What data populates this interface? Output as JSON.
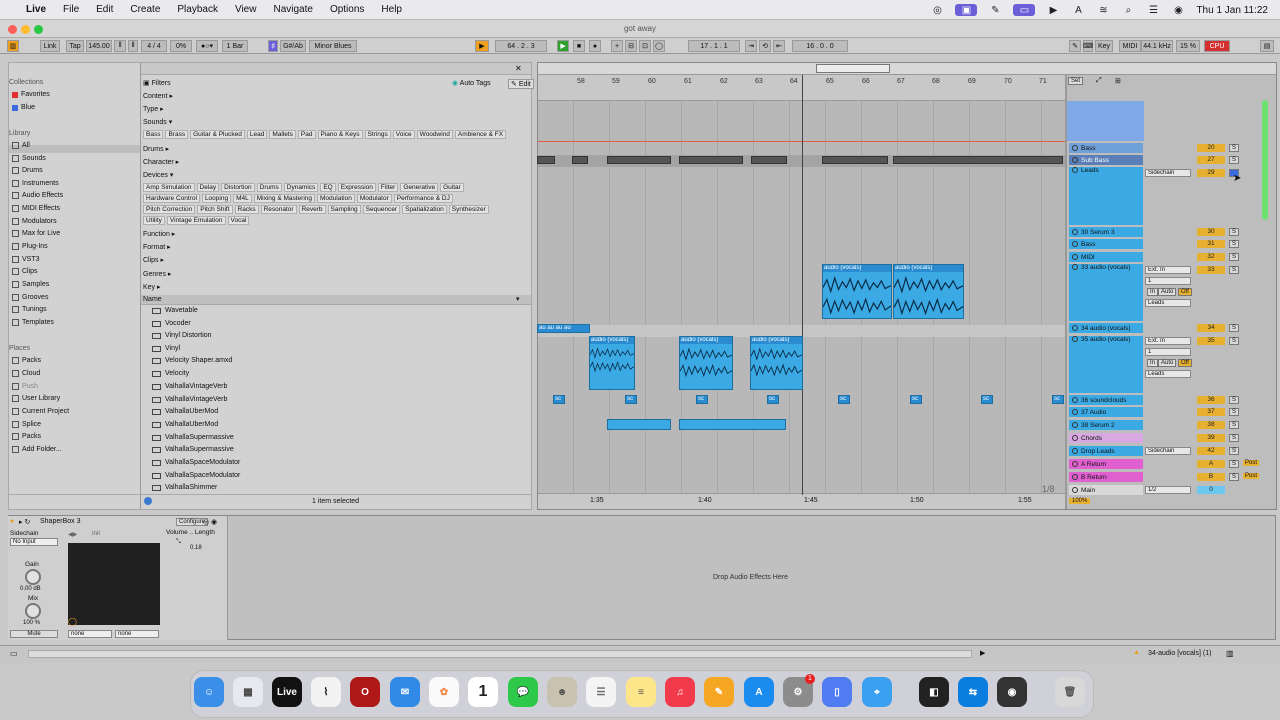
{
  "menubar": {
    "app": "Live",
    "items": [
      "File",
      "Edit",
      "Create",
      "Playback",
      "View",
      "Navigate",
      "Options",
      "Help"
    ],
    "clock": "Thu 1 Jan  11:22"
  },
  "window": {
    "title": "got away"
  },
  "control": {
    "link": "Link",
    "tap": "Tap",
    "tempo": "145.00",
    "signature": "4 / 4",
    "percent": "0%",
    "quant": "1 Bar",
    "key": "G#/Ab",
    "scale": "Minor Blues",
    "position": "64 .  2 .  3",
    "loop_start": "17 .  1 .  1",
    "loop_len": "16 .  0 .  0",
    "key_label": "Key",
    "midi_label": "MIDI",
    "sample_rate": "44.1 kHz",
    "cpu_pct": "15 %",
    "cpu": "CPU"
  },
  "browser": {
    "collections_label": "Collections",
    "favorites": "Favorites",
    "blue": "Blue",
    "library_label": "Library",
    "library": [
      "All",
      "Sounds",
      "Drums",
      "Instruments",
      "Audio Effects",
      "MIDI Effects",
      "Modulators",
      "Max for Live",
      "Plug-Ins",
      "VST3",
      "Clips",
      "Samples",
      "Grooves",
      "Tunings",
      "Templates"
    ],
    "places_label": "Places",
    "places": [
      "Packs",
      "Cloud",
      "Push",
      "User Library",
      "Current Project",
      "Splice",
      "Packs",
      "Add Folder..."
    ],
    "filters": "Filters",
    "auto_tags": "Auto Tags",
    "edit": "Edit",
    "content": "Content",
    "type": "Type",
    "sounds": "Sounds",
    "sound_tags": [
      "Bass",
      "Brass",
      "Guitar & Plucked",
      "Lead",
      "Mallets",
      "Pad",
      "Piano & Keys",
      "Strings",
      "Voice",
      "Woodwind",
      "Ambience & FX"
    ],
    "drums": "Drums",
    "character": "Character",
    "devices": "Devices",
    "device_tags1": [
      "Amp Simulation",
      "Delay",
      "Distortion",
      "Drums",
      "Dynamics",
      "EQ",
      "Expression",
      "Filter",
      "Generative",
      "Guitar"
    ],
    "device_tags2": [
      "Hardware Control",
      "Looping",
      "M4L",
      "Mixing & Mastering",
      "Modulation",
      "Modulator",
      "Performance & DJ"
    ],
    "device_tags3": [
      "Pitch Correction",
      "Pitch Shift",
      "Racks",
      "Resonator",
      "Reverb",
      "Sampling",
      "Sequencer",
      "Spatialization",
      "Synthesizer"
    ],
    "device_tags4": [
      "Utility",
      "Vintage Emulation",
      "Vocal"
    ],
    "function": "Function",
    "format": "Format",
    "clips": "Clips",
    "genres": "Genres",
    "key": "Key",
    "name_col": "Name",
    "items": [
      "Wavetable",
      "Vocoder",
      "Vinyl Distortion",
      "Vinyl",
      "Velocity Shaper.amxd",
      "Velocity",
      "ValhallaVintageVerb",
      "ValhallaVintageVerb",
      "ValhallaUberMod",
      "ValhallaUberMod",
      "ValhallaSupermassive",
      "ValhallaSupermassive",
      "ValhallaSpaceModulator",
      "ValhallaSpaceModulator",
      "ValhallaShimmer"
    ],
    "status": "1 item selected"
  },
  "arrangement": {
    "bars": [
      "58",
      "59",
      "60",
      "61",
      "62",
      "63",
      "64",
      "65",
      "66",
      "67",
      "68",
      "69",
      "70",
      "71"
    ],
    "times": [
      "1:35",
      "1:40",
      "1:45",
      "1:50",
      "1:55"
    ],
    "set_label": "Set",
    "fraction": "1/8",
    "zoom": "100%",
    "clip_vocals": "audio (vocals)",
    "clip_short": "sc",
    "clip_tiny": "au au au au"
  },
  "tracks": [
    {
      "name": "Bass",
      "num": "20",
      "color": "#6fa0d8"
    },
    {
      "name": "Sub Bass",
      "num": "27",
      "color": "#5a7fb8"
    },
    {
      "name": "Leads",
      "num": "29",
      "color": "#3aa9e4"
    },
    {
      "name": "30 Serum 3",
      "num": "30",
      "color": "#3aa9e4"
    },
    {
      "name": "Bass",
      "num": "31",
      "color": "#3aa9e4"
    },
    {
      "name": "MIDI",
      "num": "32",
      "color": "#3aa9e4"
    },
    {
      "name": "33 audio (vocals)",
      "num": "33",
      "color": "#3aa9e4"
    },
    {
      "name": "34 audio (vocals)",
      "num": "34",
      "color": "#3aa9e4"
    },
    {
      "name": "35 audio (vocals)",
      "num": "35",
      "color": "#3aa9e4"
    },
    {
      "name": "36 soundclouds",
      "num": "36",
      "color": "#3aa9e4"
    },
    {
      "name": "37 Audio",
      "num": "37",
      "color": "#3aa9e4"
    },
    {
      "name": "38 Serum 2",
      "num": "38",
      "color": "#3aa9e4"
    },
    {
      "name": "Chords",
      "num": "39",
      "color": "#d8a8e0"
    },
    {
      "name": "Drop Leads",
      "num": "42",
      "color": "#3aa9e4"
    },
    {
      "name": "A Return",
      "num": "A",
      "color": "#e060d0"
    },
    {
      "name": "B Return",
      "num": "B",
      "color": "#e060d0"
    },
    {
      "name": "Main",
      "num": "0",
      "color": "#d8d8d8"
    }
  ],
  "routing": {
    "sidechain": "Sidechain",
    "ext_in": "Ext. In",
    "one": "1",
    "in": "In",
    "auto": "Auto",
    "off": "Off",
    "leads": "Leads",
    "s": "S",
    "post": "Post",
    "half": "1/2"
  },
  "device": {
    "name": "ShaperBox 3",
    "configure": "Configure",
    "sidechain": "Sidechain",
    "no_input": "No Input",
    "gain": "Gain",
    "gain_val": "0.00 dB",
    "mix": "Mix",
    "mix_val": "100 %",
    "mute": "Mute",
    "init": "Init",
    "volume": "Volume",
    "length": "Length",
    "val": "0.18",
    "none1": "none",
    "none2": "none",
    "drop_hint": "Drop Audio Effects Here"
  },
  "statusbar": {
    "track": "34-audio [vocals] (1)"
  },
  "dock": {
    "live": "Live",
    "calendar": "1"
  }
}
